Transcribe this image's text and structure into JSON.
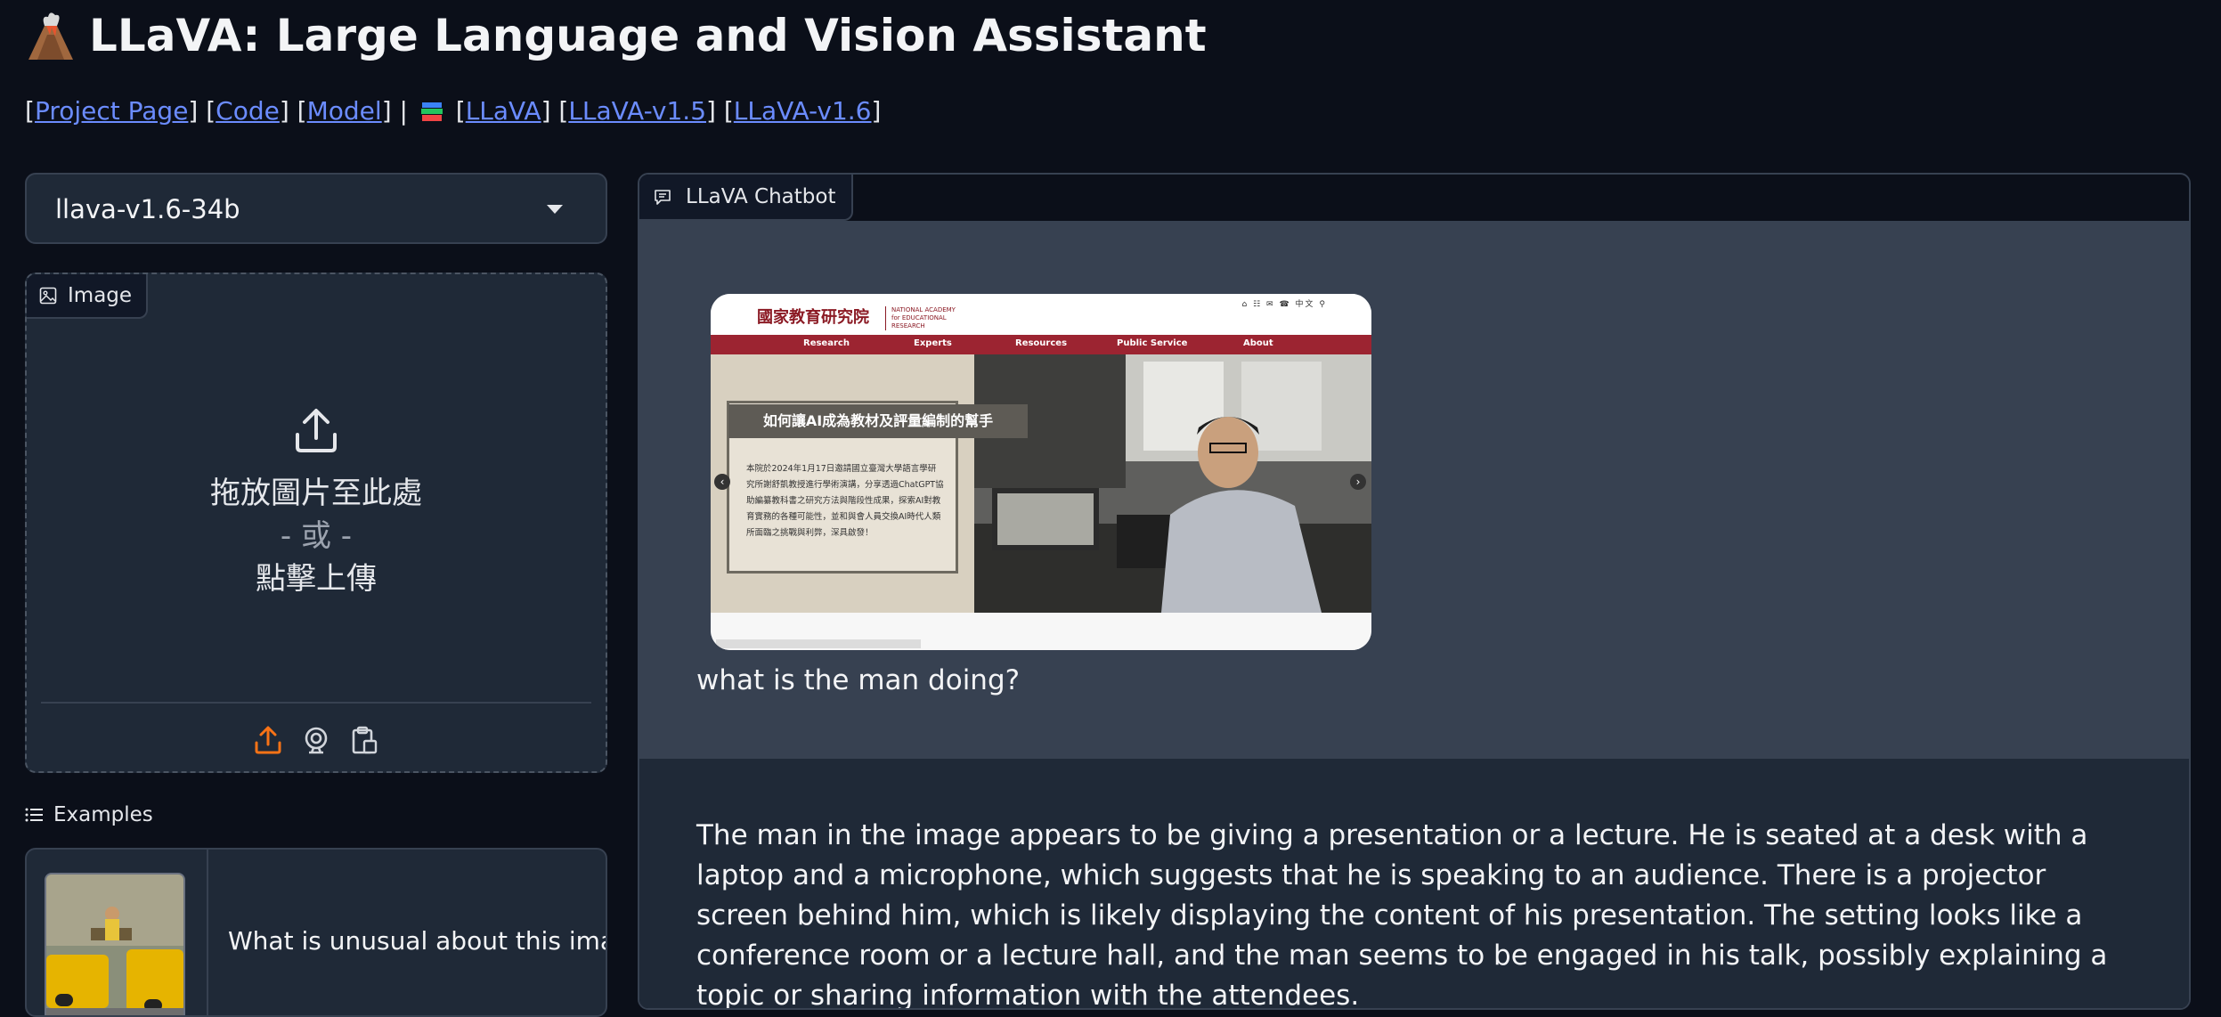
{
  "header": {
    "title": "LLaVA: Large Language and Vision Assistant",
    "title_icon": "volcano-icon"
  },
  "links": {
    "project_page": "Project Page",
    "code": "Code",
    "model": "Model",
    "separator": "|",
    "books_icon": "books-icon",
    "llava": "LLaVA",
    "llava_v15": "LLaVA-v1.5",
    "llava_v16": "LLaVA-v1.6"
  },
  "model_selector": {
    "selected": "llava-v1.6-34b"
  },
  "image_input": {
    "label": "Image",
    "drop_text": "拖放圖片至此處",
    "or_text": "- 或 -",
    "click_text": "點擊上傳"
  },
  "examples": {
    "label": "Examples",
    "items": [
      {
        "text": "What is unusual about this image?"
      }
    ]
  },
  "chatbot": {
    "label": "LLaVA Chatbot",
    "messages": [
      {
        "role": "user",
        "text": "what is the man doing?",
        "image": {
          "site_logo": "國家教育研究院",
          "site_logo_sub": "NATIONAL ACADEMY for EDUCATIONAL RESEARCH",
          "nav": [
            "Research",
            "Experts",
            "Resources",
            "Public Service",
            "About"
          ],
          "banner": "如何讓AI成為教材及評量編制的幫手",
          "card_text": "本院於2024年1月17日邀請國立臺灣大學語言學研究所謝舒凱教授進行學術演講，分享透過ChatGPT協助編纂教科書之研究方法與階段性成果，探索AI對教育實務的各種可能性，並和與會人員交換AI時代人類所面臨之挑戰與利弊，深具啟發！",
          "tools_text": "中文"
        }
      },
      {
        "role": "assistant",
        "text": "The man in the image appears to be giving a presentation or a lecture. He is seated at a desk with a laptop and a microphone, which suggests that he is speaking to an audience. There is a projector screen behind him, which is likely displaying the content of his presentation. The setting looks like a conference room or a lecture hall, and the man seems to be engaged in his talk, possibly explaining a topic or sharing information with the attendees."
      }
    ]
  },
  "colors": {
    "background": "#0b0f19",
    "panel": "#1f2937",
    "border": "#374151",
    "link": "#6b8cff",
    "accent_upload": "#f97316",
    "user_bubble": "#374151",
    "bot_bubble": "#1f2937"
  }
}
